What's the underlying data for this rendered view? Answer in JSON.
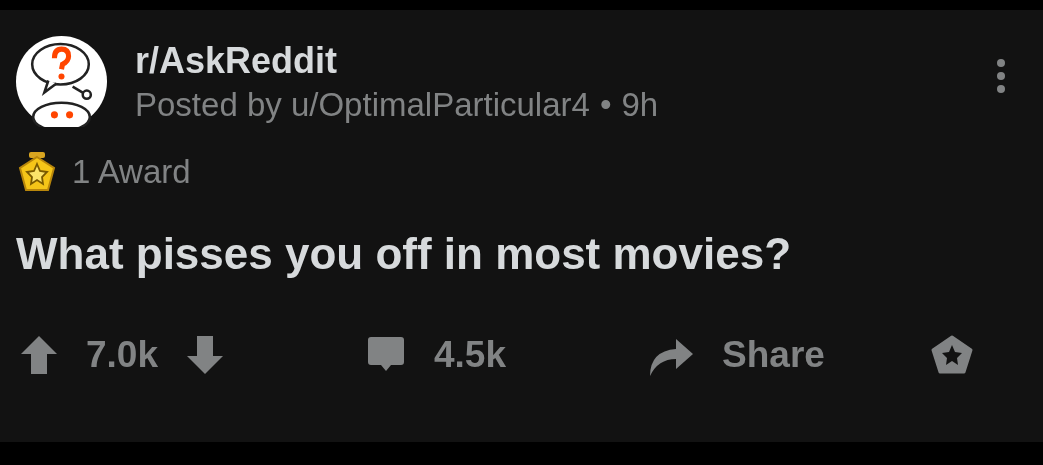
{
  "post": {
    "subreddit": "r/AskReddit",
    "byline": "Posted by u/OptimalParticular4",
    "separator": "•",
    "age": "9h",
    "awards": "1 Award",
    "title": "What pisses you off in most movies?"
  },
  "actions": {
    "upvotes": "7.0k",
    "comments": "4.5k",
    "share": "Share"
  }
}
